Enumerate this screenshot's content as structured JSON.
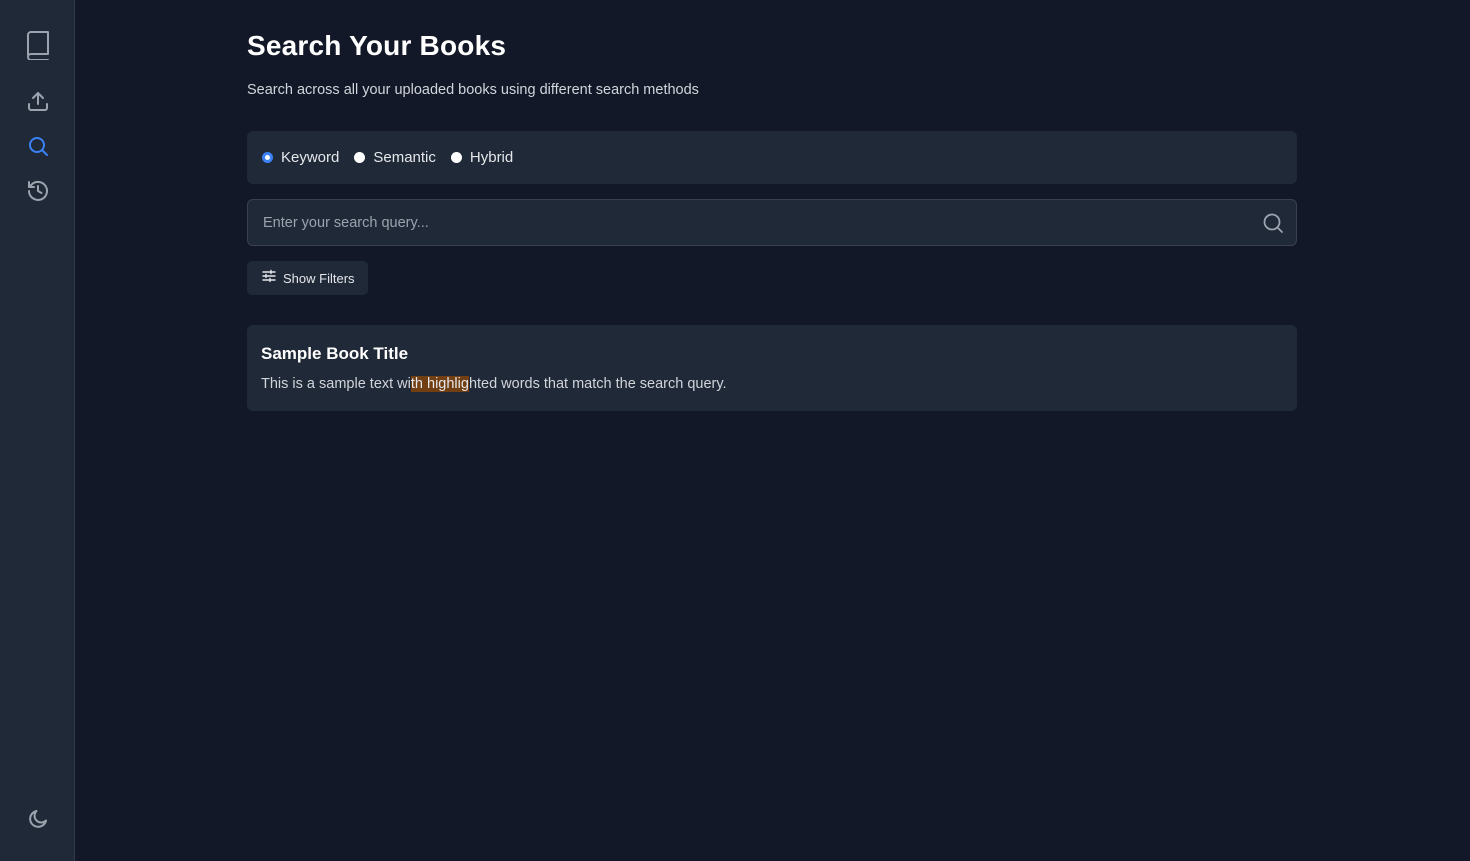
{
  "sidebar": {
    "items": [
      {
        "icon": "book-icon",
        "active": false
      },
      {
        "icon": "upload-icon",
        "active": false
      },
      {
        "icon": "search-icon",
        "active": true
      },
      {
        "icon": "history-icon",
        "active": false
      }
    ],
    "footer_icon": "moon-icon"
  },
  "header": {
    "title": "Search Your Books",
    "subtitle": "Search across all your uploaded books using different search methods"
  },
  "search_modes": {
    "options": [
      {
        "label": "Keyword",
        "checked": true
      },
      {
        "label": "Semantic",
        "checked": false
      },
      {
        "label": "Hybrid",
        "checked": false
      }
    ]
  },
  "search": {
    "placeholder": "Enter your search query...",
    "value": ""
  },
  "filters": {
    "label": "Show Filters"
  },
  "results": [
    {
      "title": "Sample Book Title",
      "snippet_before": "This is a sample text wi",
      "snippet_highlight": "th highlig",
      "snippet_after": "hted words that match the search query."
    }
  ],
  "colors": {
    "background": "#121827",
    "panel": "#1f2937",
    "accent": "#3b82f6",
    "highlight": "#713f12",
    "icon": "#9ca3af"
  }
}
